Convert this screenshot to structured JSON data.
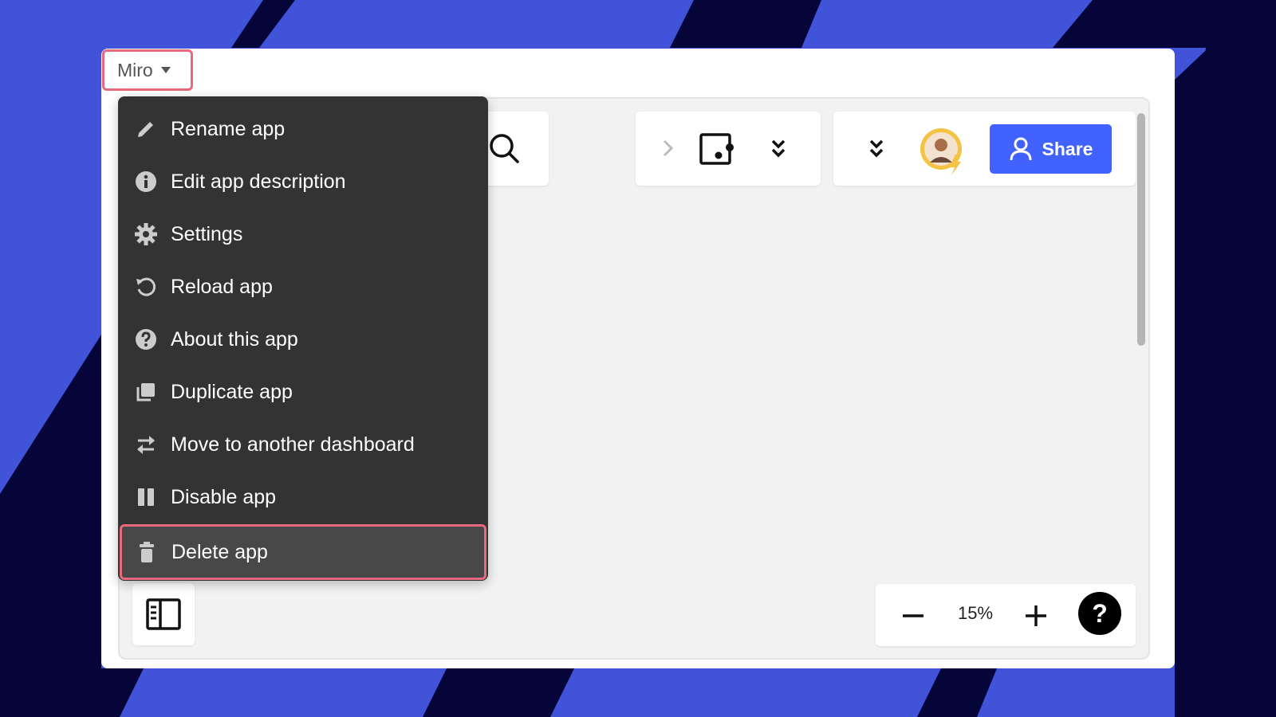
{
  "app": {
    "title": "Miro"
  },
  "menu": {
    "items": [
      {
        "label": "Rename app",
        "icon": "pencil-icon"
      },
      {
        "label": "Edit app description",
        "icon": "info-icon"
      },
      {
        "label": "Settings",
        "icon": "gear-icon"
      },
      {
        "label": "Reload app",
        "icon": "reload-icon"
      },
      {
        "label": "About this app",
        "icon": "question-icon"
      },
      {
        "label": "Duplicate app",
        "icon": "duplicate-icon"
      },
      {
        "label": "Move to another dashboard",
        "icon": "swap-arrows-icon"
      },
      {
        "label": "Disable app",
        "icon": "pause-icon"
      },
      {
        "label": "Delete app",
        "icon": "trash-icon",
        "highlighted": true
      }
    ]
  },
  "toolbar": {
    "share_label": "Share"
  },
  "zoom": {
    "level": "15%",
    "help_label": "?"
  },
  "colors": {
    "background": "#4053d9",
    "background_stripe": "#05053a",
    "menu_bg": "#333333",
    "highlight": "#e8697d",
    "share_button": "#4262ff"
  }
}
